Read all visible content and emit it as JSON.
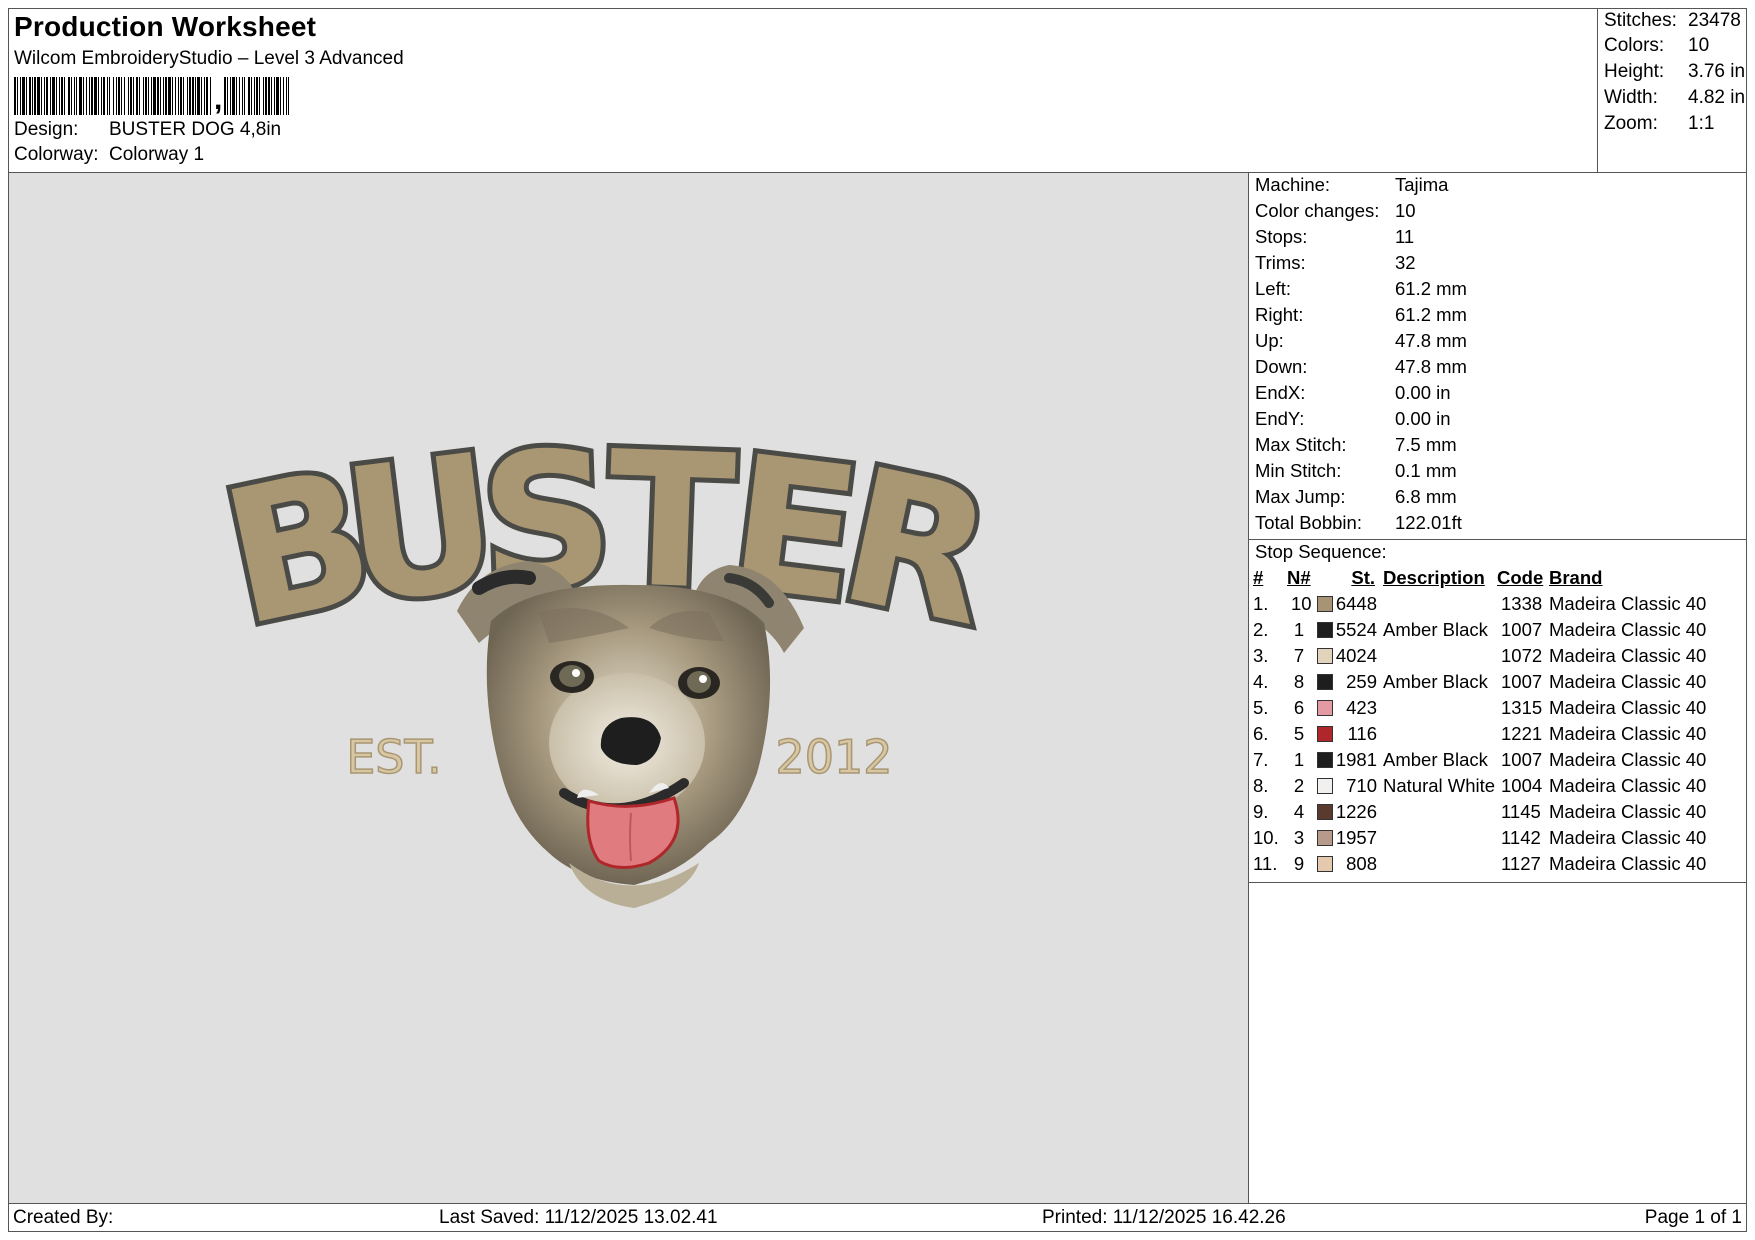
{
  "header": {
    "title": "Production Worksheet",
    "software": "Wilcom EmbroideryStudio – Level 3 Advanced",
    "design_label": "Design:",
    "design_value": "BUSTER DOG 4,8in",
    "colorway_label": "Colorway:",
    "colorway_value": "Colorway 1"
  },
  "stats": [
    {
      "label": "Stitches:",
      "value": "23478"
    },
    {
      "label": "Colors:",
      "value": "10"
    },
    {
      "label": "Height:",
      "value": "3.76 in"
    },
    {
      "label": "Width:",
      "value": "4.82 in"
    },
    {
      "label": "Zoom:",
      "value": "1:1"
    }
  ],
  "preview": {
    "word": "BUSTER",
    "est": "EST.",
    "year": "2012",
    "colors": {
      "fill": "#a99672",
      "outline": "#4a4a46",
      "est": "#d8c7a3",
      "background": "#e0e0e0"
    }
  },
  "machine_info": [
    {
      "label": "Machine:",
      "value": "Tajima"
    },
    {
      "label": "Color changes:",
      "value": "10"
    },
    {
      "label": "Stops:",
      "value": "11"
    },
    {
      "label": "Trims:",
      "value": "32"
    },
    {
      "label": "Left:",
      "value": "61.2 mm"
    },
    {
      "label": "Right:",
      "value": "61.2 mm"
    },
    {
      "label": "Up:",
      "value": "47.8 mm"
    },
    {
      "label": "Down:",
      "value": "47.8 mm"
    },
    {
      "label": "EndX:",
      "value": "0.00 in"
    },
    {
      "label": "EndY:",
      "value": "0.00 in"
    },
    {
      "label": "Max Stitch:",
      "value": "7.5 mm"
    },
    {
      "label": "Min Stitch:",
      "value": "0.1 mm"
    },
    {
      "label": "Max Jump:",
      "value": "6.8 mm"
    },
    {
      "label": "Total Bobbin:",
      "value": "122.01ft"
    }
  ],
  "stop_sequence": {
    "title": "Stop Sequence:",
    "headers": {
      "num": "#",
      "n": "N#",
      "st": "St.",
      "desc": "Description",
      "code": "Code",
      "brand": "Brand"
    },
    "rows": [
      {
        "num": "1.",
        "n": "10",
        "color": "#a89372",
        "st": "6448",
        "desc": "",
        "code": "1338",
        "brand": "Madeira Classic 40"
      },
      {
        "num": "2.",
        "n": "1",
        "color": "#1e1e1e",
        "st": "5524",
        "desc": "Amber Black",
        "code": "1007",
        "brand": "Madeira Classic 40"
      },
      {
        "num": "3.",
        "n": "7",
        "color": "#e2d3bd",
        "st": "4024",
        "desc": "",
        "code": "1072",
        "brand": "Madeira Classic 40"
      },
      {
        "num": "4.",
        "n": "8",
        "color": "#1e1e1e",
        "st": "259",
        "desc": "Amber Black",
        "code": "1007",
        "brand": "Madeira Classic 40"
      },
      {
        "num": "5.",
        "n": "6",
        "color": "#e39aa3",
        "st": "423",
        "desc": "",
        "code": "1315",
        "brand": "Madeira Classic 40"
      },
      {
        "num": "6.",
        "n": "5",
        "color": "#b0272b",
        "st": "116",
        "desc": "",
        "code": "1221",
        "brand": "Madeira Classic 40"
      },
      {
        "num": "7.",
        "n": "1",
        "color": "#1e1e1e",
        "st": "1981",
        "desc": "Amber Black",
        "code": "1007",
        "brand": "Madeira Classic 40"
      },
      {
        "num": "8.",
        "n": "2",
        "color": "#f1f0ee",
        "st": "710",
        "desc": "Natural White",
        "code": "1004",
        "brand": "Madeira Classic 40"
      },
      {
        "num": "9.",
        "n": "4",
        "color": "#5a3a2e",
        "st": "1226",
        "desc": "",
        "code": "1145",
        "brand": "Madeira Classic 40"
      },
      {
        "num": "10.",
        "n": "3",
        "color": "#b89a8b",
        "st": "1957",
        "desc": "",
        "code": "1142",
        "brand": "Madeira Classic 40"
      },
      {
        "num": "11.",
        "n": "9",
        "color": "#e5c9ae",
        "st": "808",
        "desc": "",
        "code": "1127",
        "brand": "Madeira Classic 40"
      }
    ]
  },
  "footer": {
    "created_by": "Created By:",
    "last_saved": "Last Saved: 11/12/2025 13.02.41",
    "printed": "Printed: 11/12/2025 16.42.26",
    "page": "Page 1 of 1"
  }
}
